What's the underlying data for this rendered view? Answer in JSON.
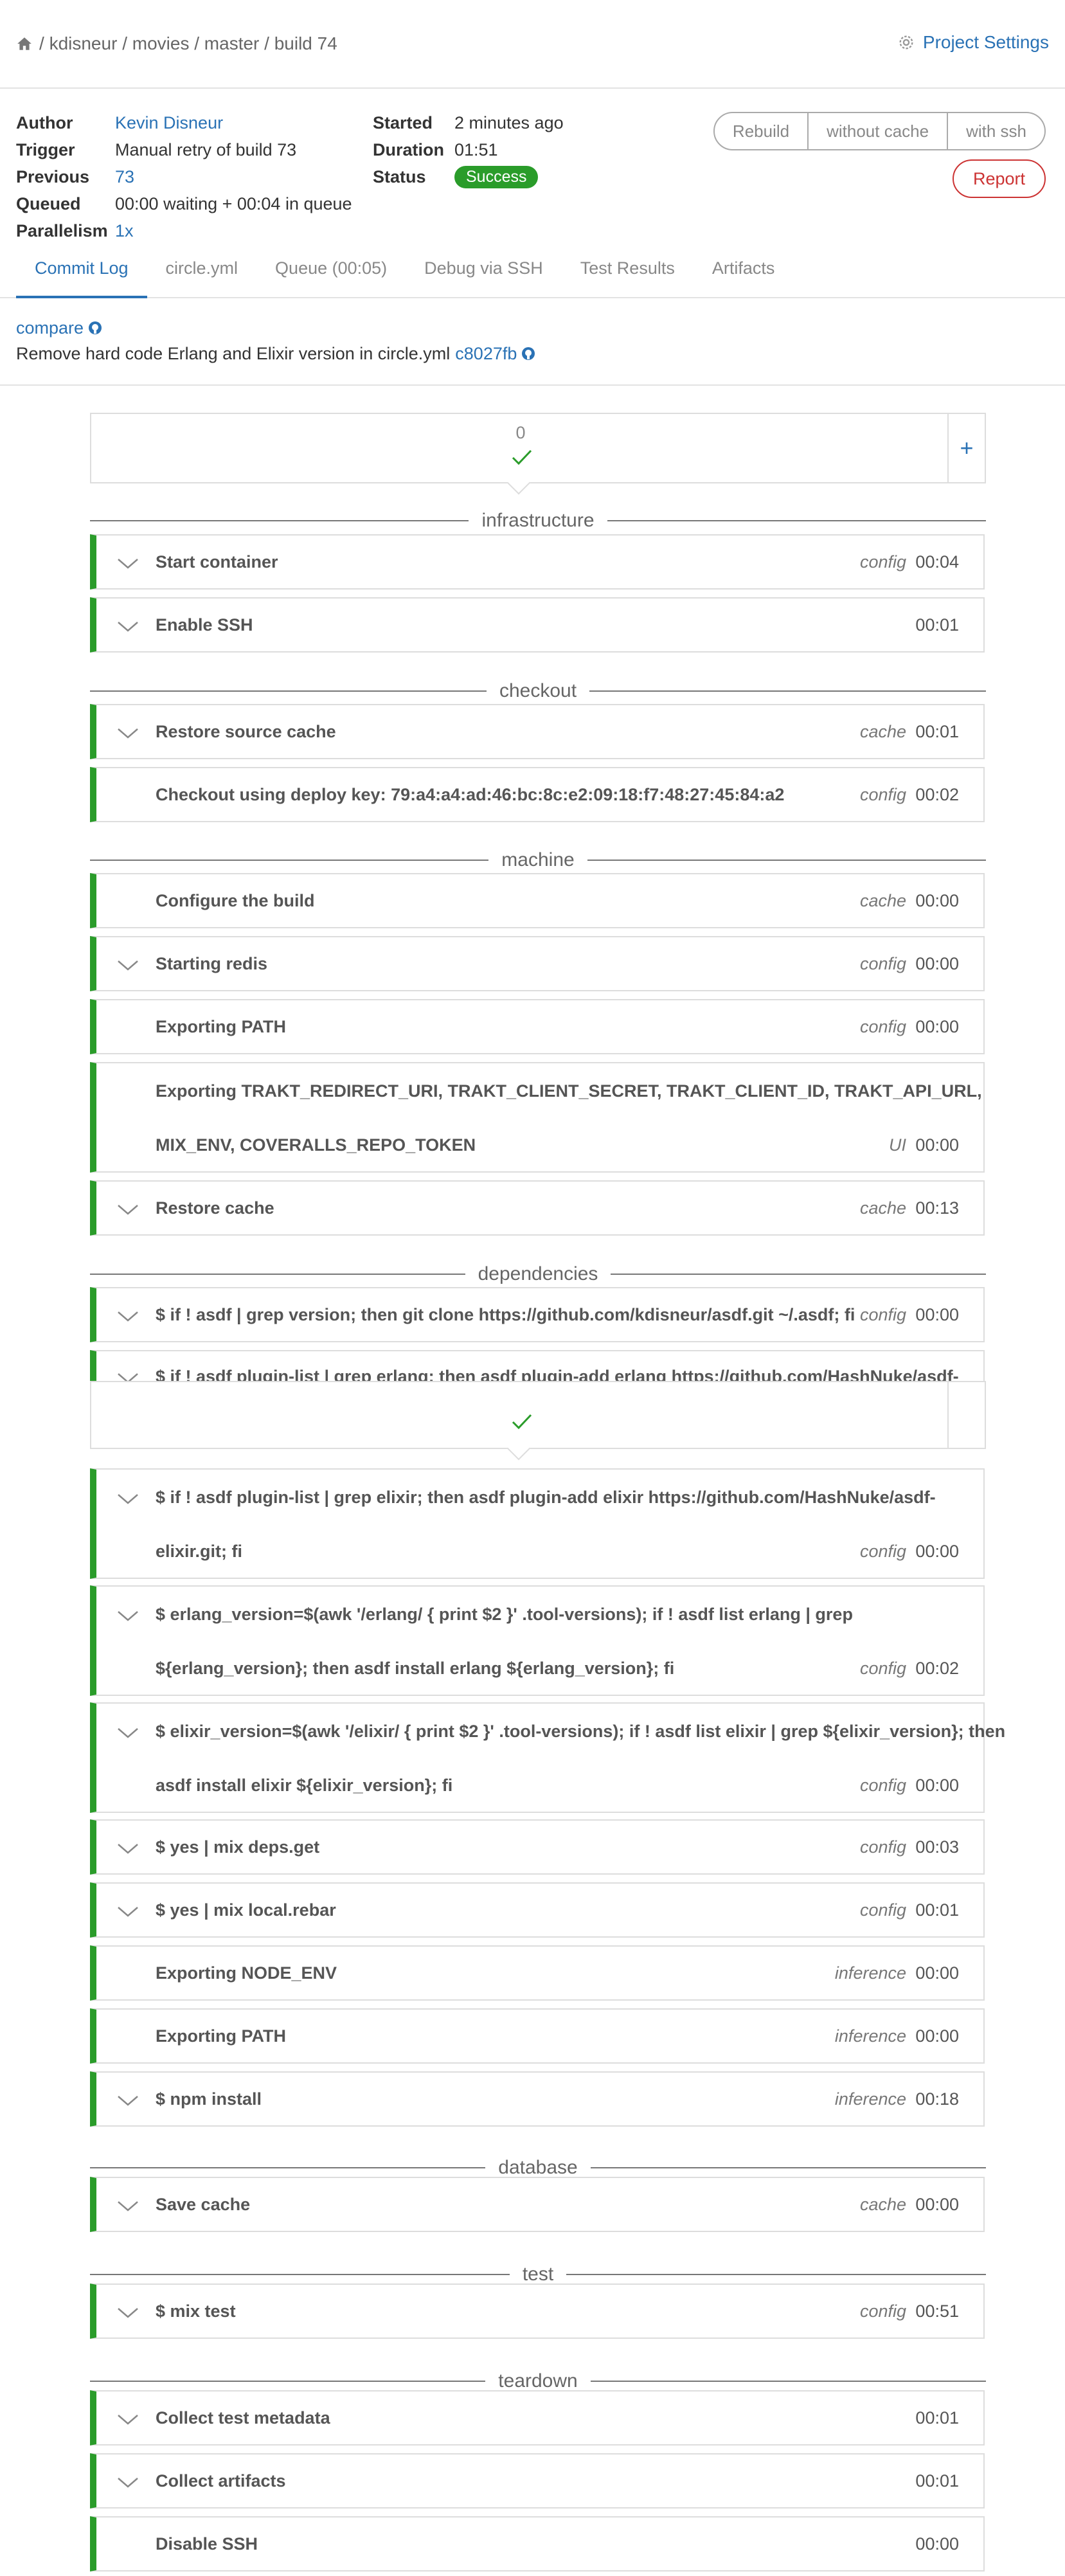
{
  "breadcrumb": {
    "items": [
      "kdisneur",
      "movies",
      "master",
      "build 74"
    ],
    "separator": "/"
  },
  "header": {
    "settings_label": "Project Settings"
  },
  "build": {
    "author_label": "Author",
    "author": "Kevin Disneur",
    "trigger_label": "Trigger",
    "trigger": "Manual retry of build 73",
    "previous_label": "Previous",
    "previous": "73",
    "queued_label": "Queued",
    "queued": "00:00 waiting + 00:04 in queue",
    "parallelism_label": "Parallelism",
    "parallelism": "1x",
    "started_label": "Started",
    "started": "2 minutes ago",
    "duration_label": "Duration",
    "duration": "01:51",
    "status_label": "Status",
    "status": "Success"
  },
  "actions": {
    "rebuild": "Rebuild",
    "without_cache": "without cache",
    "with_ssh": "with ssh",
    "report": "Report"
  },
  "tabs": [
    "Commit Log",
    "circle.yml",
    "Queue (00:05)",
    "Debug via SSH",
    "Test Results",
    "Artifacts"
  ],
  "commit": {
    "compare": "compare",
    "message": "Remove hard code Erlang and Elixir version in circle.yml",
    "sha": "c8027fb"
  },
  "container": {
    "number": "0",
    "plus": "+"
  },
  "sections": [
    {
      "name": "infrastructure",
      "steps": [
        {
          "title": "Start container",
          "source": "config",
          "time": "00:04",
          "expandable": true
        },
        {
          "title": "Enable SSH",
          "source": "",
          "time": "00:01",
          "expandable": true
        }
      ]
    },
    {
      "name": "checkout",
      "steps": [
        {
          "title": "Restore source cache",
          "source": "cache",
          "time": "00:01",
          "expandable": true
        },
        {
          "title": "Checkout using deploy key: 79:a4:a4:ad:46:bc:8c:e2:09:18:f7:48:27:45:84:a2",
          "source": "config",
          "time": "00:02",
          "expandable": false
        }
      ]
    },
    {
      "name": "machine",
      "steps": [
        {
          "title": "Configure the build",
          "source": "cache",
          "time": "00:00",
          "expandable": false
        },
        {
          "title": "Starting redis",
          "source": "config",
          "time": "00:00",
          "expandable": true
        },
        {
          "title": "Exporting PATH",
          "source": "config",
          "time": "00:00",
          "expandable": false
        },
        {
          "title": "Exporting TRAKT_REDIRECT_URI, TRAKT_CLIENT_SECRET, TRAKT_CLIENT_ID, TRAKT_API_URL,",
          "title2": "MIX_ENV, COVERALLS_REPO_TOKEN",
          "source": "UI",
          "time": "00:00",
          "expandable": false
        },
        {
          "title": "Restore cache",
          "source": "cache",
          "time": "00:13",
          "expandable": true
        }
      ]
    },
    {
      "name": "dependencies",
      "steps": [
        {
          "title": "$ if ! asdf | grep version; then git clone https://github.com/kdisneur/asdf.git ~/.asdf; fi",
          "source": "config",
          "time": "00:00",
          "expandable": true
        },
        {
          "title": "$ if ! asdf plugin-list | grep erlang; then asdf plugin-add erlang https://github.com/HashNuke/asdf-",
          "source": "",
          "time": "",
          "expandable": true
        },
        {
          "title": "$ if ! asdf plugin-list | grep elixir; then asdf plugin-add elixir https://github.com/HashNuke/asdf-",
          "title2": "elixir.git; fi",
          "source": "config",
          "time": "00:00",
          "expandable": true
        },
        {
          "title": "$ erlang_version=$(awk '/erlang/ { print $2 }' .tool-versions); if ! asdf list erlang | grep",
          "title2": "${erlang_version}; then asdf install erlang ${erlang_version}; fi",
          "source": "config",
          "time": "00:02",
          "expandable": true
        },
        {
          "title": "$ elixir_version=$(awk '/elixir/ { print $2 }' .tool-versions); if ! asdf list elixir | grep ${elixir_version}; then",
          "title2": "asdf install elixir ${elixir_version}; fi",
          "source": "config",
          "time": "00:00",
          "expandable": true
        },
        {
          "title": "$ yes | mix deps.get",
          "source": "config",
          "time": "00:03",
          "expandable": true
        },
        {
          "title": "$ yes | mix local.rebar",
          "source": "config",
          "time": "00:01",
          "expandable": true
        },
        {
          "title": "Exporting NODE_ENV",
          "source": "inference",
          "time": "00:00",
          "expandable": false
        },
        {
          "title": "Exporting PATH",
          "source": "inference",
          "time": "00:00",
          "expandable": false
        },
        {
          "title": "$ npm install",
          "source": "inference",
          "time": "00:18",
          "expandable": true
        }
      ]
    },
    {
      "name": "database",
      "steps": [
        {
          "title": "Save cache",
          "source": "cache",
          "time": "00:00",
          "expandable": true
        }
      ]
    },
    {
      "name": "test",
      "steps": [
        {
          "title": "$ mix test",
          "source": "config",
          "time": "00:51",
          "expandable": true
        }
      ]
    },
    {
      "name": "teardown",
      "steps": [
        {
          "title": "Collect test metadata",
          "source": "",
          "time": "00:01",
          "expandable": true
        },
        {
          "title": "Collect artifacts",
          "source": "",
          "time": "00:01",
          "expandable": true
        },
        {
          "title": "Disable SSH",
          "source": "",
          "time": "00:00",
          "expandable": false
        }
      ]
    }
  ],
  "colors": {
    "link": "#2a72b5",
    "success": "#2a9c2a",
    "danger": "#cc3333"
  }
}
